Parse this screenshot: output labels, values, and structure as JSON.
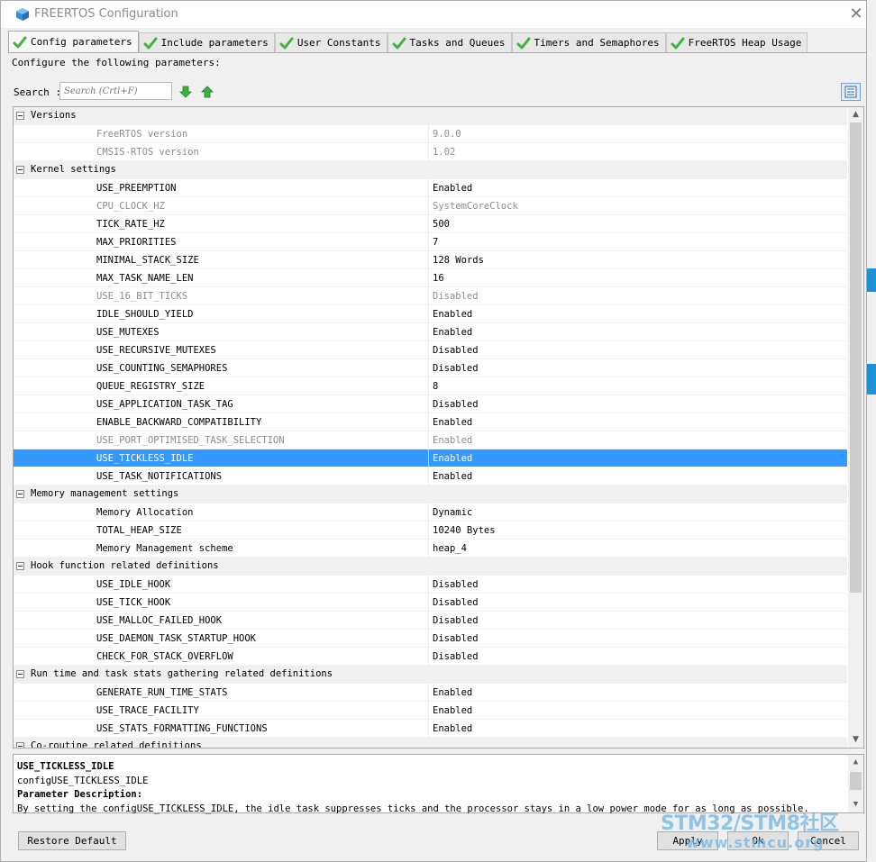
{
  "window": {
    "title": "FREERTOS Configuration"
  },
  "tabs": [
    {
      "label": "Config parameters",
      "active": true
    },
    {
      "label": "Include parameters"
    },
    {
      "label": "User Constants"
    },
    {
      "label": "Tasks and Queues"
    },
    {
      "label": "Timers and Semaphores"
    },
    {
      "label": "FreeRTOS Heap Usage"
    }
  ],
  "subtitle": "Configure the following parameters:",
  "search": {
    "label": "Search :",
    "placeholder": "Search (Crtl+F)"
  },
  "groups": [
    {
      "name": "Versions",
      "params": [
        {
          "name": "FreeRTOS version",
          "value": "9.0.0",
          "disabled": true
        },
        {
          "name": "CMSIS-RTOS version",
          "value": "1.02",
          "disabled": true
        }
      ]
    },
    {
      "name": "Kernel settings",
      "params": [
        {
          "name": "USE_PREEMPTION",
          "value": "Enabled"
        },
        {
          "name": "CPU_CLOCK_HZ",
          "value": "SystemCoreClock",
          "disabled": true
        },
        {
          "name": "TICK_RATE_HZ",
          "value": "500"
        },
        {
          "name": "MAX_PRIORITIES",
          "value": "7"
        },
        {
          "name": "MINIMAL_STACK_SIZE",
          "value": "128 Words"
        },
        {
          "name": "MAX_TASK_NAME_LEN",
          "value": "16"
        },
        {
          "name": "USE_16_BIT_TICKS",
          "value": "Disabled",
          "disabled": true
        },
        {
          "name": "IDLE_SHOULD_YIELD",
          "value": "Enabled"
        },
        {
          "name": "USE_MUTEXES",
          "value": "Enabled"
        },
        {
          "name": "USE_RECURSIVE_MUTEXES",
          "value": "Disabled"
        },
        {
          "name": "USE_COUNTING_SEMAPHORES",
          "value": "Disabled"
        },
        {
          "name": "QUEUE_REGISTRY_SIZE",
          "value": "8"
        },
        {
          "name": "USE_APPLICATION_TASK_TAG",
          "value": "Disabled"
        },
        {
          "name": "ENABLE_BACKWARD_COMPATIBILITY",
          "value": "Enabled"
        },
        {
          "name": "USE_PORT_OPTIMISED_TASK_SELECTION",
          "value": "Enabled",
          "disabled": true
        },
        {
          "name": "USE_TICKLESS_IDLE",
          "value": "Enabled",
          "selected": true
        },
        {
          "name": "USE_TASK_NOTIFICATIONS",
          "value": "Enabled"
        }
      ]
    },
    {
      "name": "Memory management settings",
      "params": [
        {
          "name": "Memory Allocation",
          "value": "Dynamic"
        },
        {
          "name": "TOTAL_HEAP_SIZE",
          "value": "10240 Bytes"
        },
        {
          "name": "Memory Management scheme",
          "value": "heap_4"
        }
      ]
    },
    {
      "name": "Hook function related definitions",
      "params": [
        {
          "name": "USE_IDLE_HOOK",
          "value": "Disabled"
        },
        {
          "name": "USE_TICK_HOOK",
          "value": "Disabled"
        },
        {
          "name": "USE_MALLOC_FAILED_HOOK",
          "value": "Disabled"
        },
        {
          "name": "USE_DAEMON_TASK_STARTUP_HOOK",
          "value": "Disabled"
        },
        {
          "name": "CHECK_FOR_STACK_OVERFLOW",
          "value": "Disabled"
        }
      ]
    },
    {
      "name": "Run time and task stats gathering related definitions",
      "params": [
        {
          "name": "GENERATE_RUN_TIME_STATS",
          "value": "Enabled"
        },
        {
          "name": "USE_TRACE_FACILITY",
          "value": "Enabled"
        },
        {
          "name": "USE_STATS_FORMATTING_FUNCTIONS",
          "value": "Enabled"
        }
      ]
    },
    {
      "name": "Co-routine related definitions",
      "params": []
    }
  ],
  "description": {
    "title": "USE_TICKLESS_IDLE",
    "config_name": "configUSE_TICKLESS_IDLE",
    "section_label": "Parameter Description:",
    "text": "By setting the configUSE_TICKLESS_IDLE, the idle task suppresses ticks and the processor stays in a low power mode for as long as possible."
  },
  "buttons": {
    "restore": "Restore Default",
    "apply": "Apply",
    "ok": "Ok",
    "cancel": "Cancel"
  },
  "watermark": {
    "line1": "STM32/STM8社区",
    "line2": "www.stmcu.org"
  },
  "colors": {
    "selection": "#3399ff",
    "check": "#3fb23f",
    "watermark": "#6cb6e6"
  }
}
